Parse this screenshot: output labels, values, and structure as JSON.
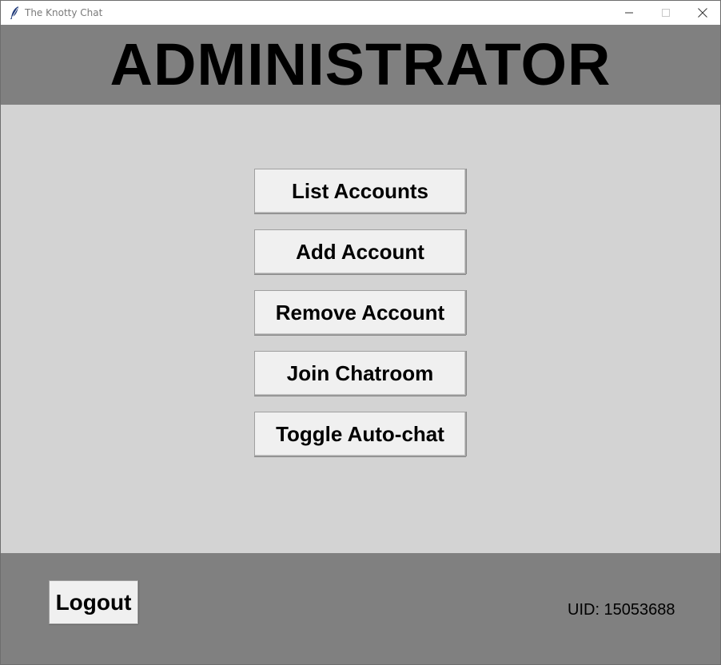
{
  "window": {
    "title": "The Knotty Chat",
    "icon": "feather-icon"
  },
  "header": {
    "title": "ADMINISTRATOR"
  },
  "menu": {
    "buttons": [
      {
        "label": "List Accounts"
      },
      {
        "label": "Add Account"
      },
      {
        "label": "Remove Account"
      },
      {
        "label": "Join Chatroom"
      },
      {
        "label": "Toggle Auto-chat"
      }
    ]
  },
  "footer": {
    "logout_label": "Logout",
    "uid_text": "UID: 15053688"
  },
  "colors": {
    "header_bg": "#808080",
    "main_bg": "#d3d3d3",
    "button_bg": "#f0f0f0"
  }
}
